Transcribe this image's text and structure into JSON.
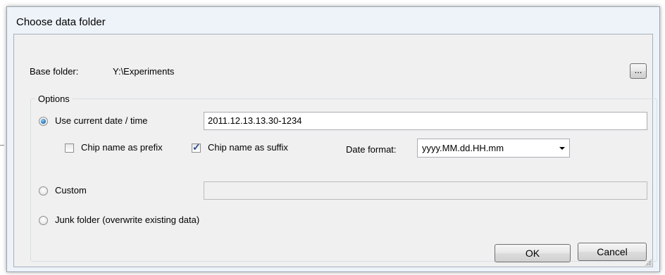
{
  "dialog": {
    "title": "Choose data folder"
  },
  "base_folder": {
    "label": "Base folder:",
    "value": "Y:\\Experiments",
    "browse_label": "..."
  },
  "options": {
    "group_title": "Options",
    "use_current_date": {
      "label": "Use current date / time",
      "checked": true,
      "value": "2011.12.13.13.30-1234"
    },
    "chip_prefix": {
      "label": "Chip name as prefix",
      "checked": false
    },
    "chip_suffix": {
      "label": "Chip name as suffix",
      "checked": true
    },
    "date_format": {
      "label": "Date format:",
      "value": "yyyy.MM.dd.HH.mm"
    },
    "custom": {
      "label": "Custom",
      "checked": false,
      "value": ""
    },
    "junk": {
      "label": "Junk folder (overwrite existing data)",
      "checked": false
    }
  },
  "buttons": {
    "ok": "OK",
    "cancel": "Cancel"
  }
}
